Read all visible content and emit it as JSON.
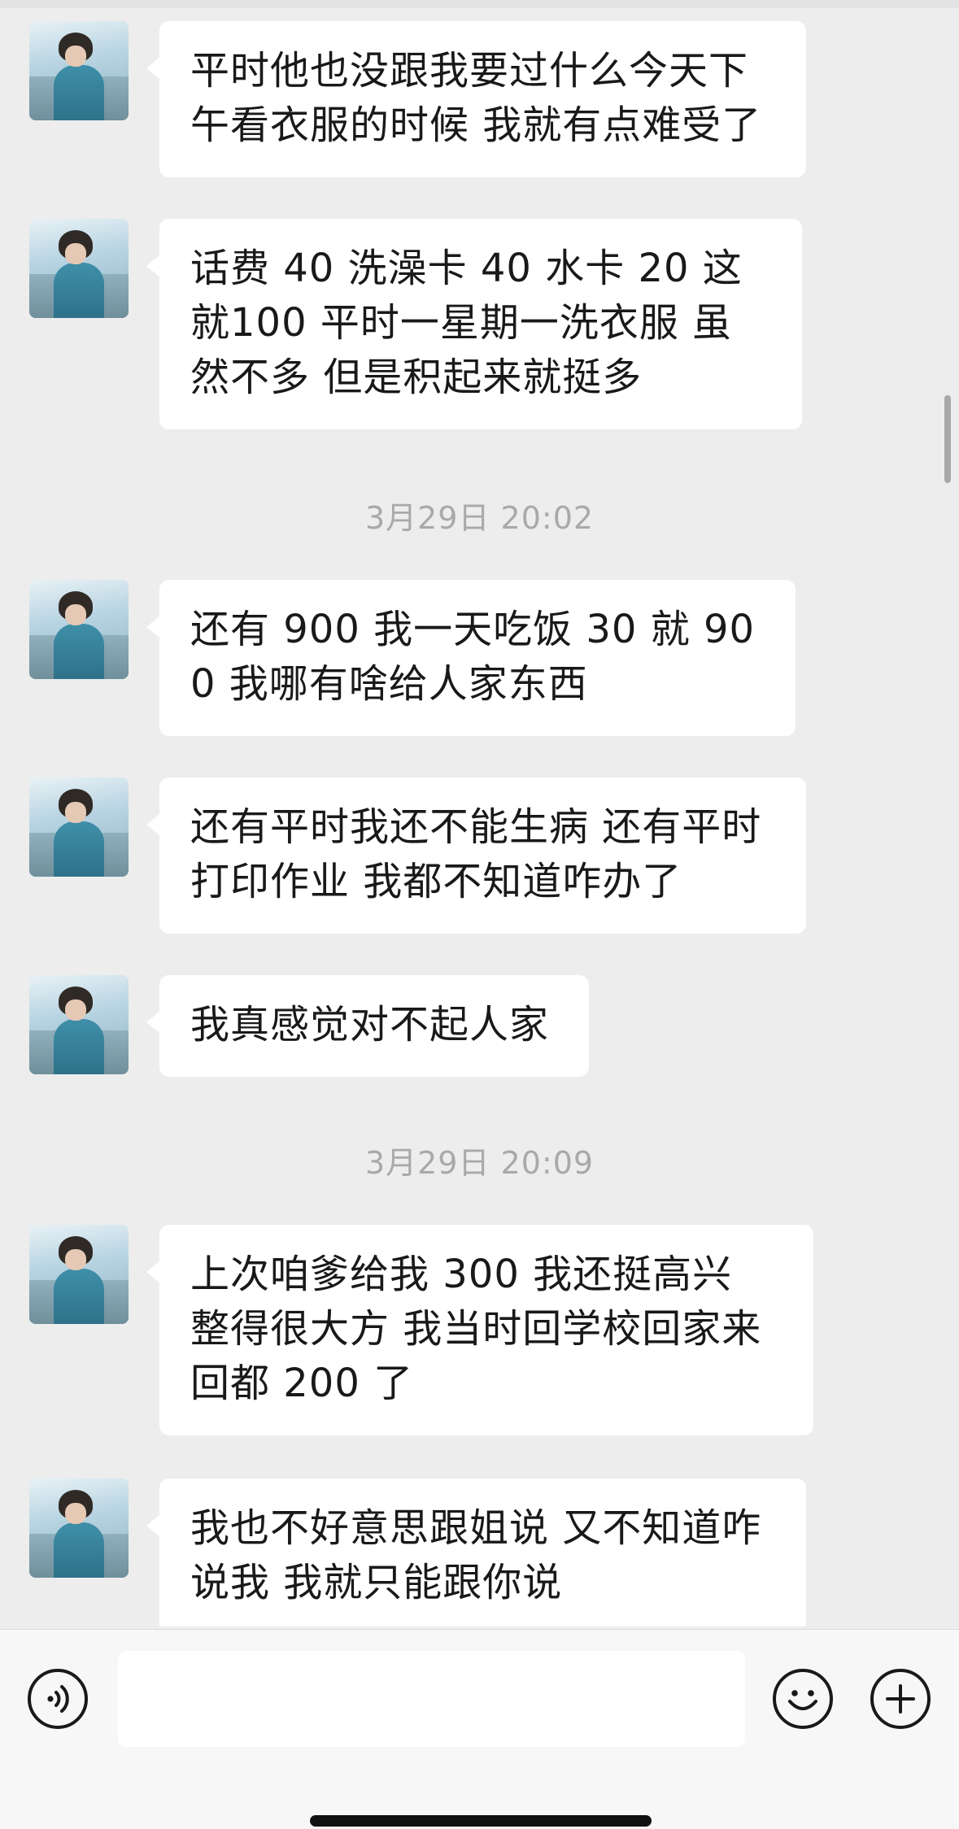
{
  "messages": [
    {
      "type": "received",
      "text": "平时他也没跟我要过什么今天下午看衣服的时候 我就有点难受了"
    },
    {
      "type": "received",
      "text": "话费 40 洗澡卡 40 水卡 20 这就100 平时一星期一洗衣服 虽然不多 但是积起来就挺多"
    },
    {
      "type": "timestamp",
      "text": "3月29日 20:02"
    },
    {
      "type": "received",
      "text": "还有 900 我一天吃饭 30 就 900 我哪有啥给人家东西"
    },
    {
      "type": "received",
      "text": "还有平时我还不能生病 还有平时打印作业 我都不知道咋办了"
    },
    {
      "type": "received",
      "text": "我真感觉对不起人家"
    },
    {
      "type": "timestamp",
      "text": "3月29日 20:09"
    },
    {
      "type": "received",
      "text": "上次咱爹给我 300 我还挺高兴 整得很大方 我当时回学校回家来回都 200 了"
    },
    {
      "type": "received",
      "text": "我也不好意思跟姐说 又不知道咋说我 我就只能跟你说"
    }
  ],
  "input_bar": {
    "voice_icon": "voice-icon",
    "emoji_icon": "emoji-icon",
    "plus_icon": "plus-icon",
    "input_value": ""
  }
}
